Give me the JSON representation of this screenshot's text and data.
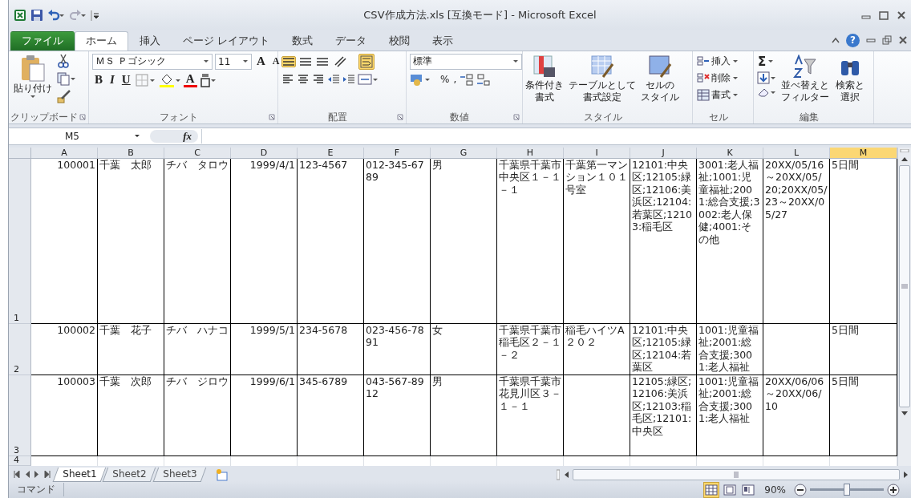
{
  "window": {
    "title": "CSV作成方法.xls  [互換モード] - Microsoft Excel"
  },
  "tabs": [
    {
      "label": "ファイル",
      "kind": "file",
      "selected": false
    },
    {
      "label": "ホーム",
      "kind": "tab",
      "selected": true
    },
    {
      "label": "挿入",
      "kind": "tab",
      "selected": false
    },
    {
      "label": "ページ レイアウト",
      "kind": "tab",
      "selected": false
    },
    {
      "label": "数式",
      "kind": "tab",
      "selected": false
    },
    {
      "label": "データ",
      "kind": "tab",
      "selected": false
    },
    {
      "label": "校閲",
      "kind": "tab",
      "selected": false
    },
    {
      "label": "表示",
      "kind": "tab",
      "selected": false
    }
  ],
  "help": "?",
  "ribbon": {
    "clipboard": {
      "label": "クリップボード",
      "paste": "貼り付け"
    },
    "font": {
      "label": "フォント",
      "name": "ＭＳ Ｐゴシック",
      "size": "11",
      "grow": "A",
      "shrink": "A",
      "bold": "B",
      "italic": "I",
      "underline": "U",
      "color_letter": "A"
    },
    "alignment": {
      "label": "配置",
      "toggles": [
        {
          "kind": "top",
          "on": true
        },
        {
          "kind": "middle",
          "on": false
        },
        {
          "kind": "bottom",
          "on": false
        },
        {
          "kind": "orientation",
          "on": false
        },
        {
          "kind": "wrap",
          "on": true
        }
      ]
    },
    "number": {
      "label": "数値",
      "format": "標準",
      "percent": "%",
      "comma": ","
    },
    "styles": {
      "label": "スタイル",
      "buttons": [
        {
          "lines": [
            "条件付き",
            "書式"
          ]
        },
        {
          "lines": [
            "テーブルとして",
            "書式設定"
          ]
        },
        {
          "lines": [
            "セルの",
            "スタイル"
          ]
        }
      ]
    },
    "cells": {
      "label": "セル",
      "buttons": [
        "挿入",
        "削除",
        "書式"
      ]
    },
    "editing": {
      "label": "編集",
      "sum": "Σ",
      "buttons": [
        {
          "lines": [
            "並べ替えと",
            "フィルター"
          ]
        },
        {
          "lines": [
            "検索と",
            "選択"
          ]
        }
      ]
    }
  },
  "formula_bar": {
    "name_box": "M5",
    "function_label": "fx"
  },
  "sheet": {
    "columns": [
      {
        "label": "A",
        "kind": "number",
        "selected": false
      },
      {
        "label": "B",
        "kind": "text",
        "selected": false
      },
      {
        "label": "C",
        "kind": "text",
        "selected": false
      },
      {
        "label": "D",
        "kind": "number",
        "selected": false
      },
      {
        "label": "E",
        "kind": "text",
        "selected": false
      },
      {
        "label": "F",
        "kind": "text",
        "selected": false
      },
      {
        "label": "G",
        "kind": "text",
        "selected": false
      },
      {
        "label": "H",
        "kind": "text",
        "selected": false
      },
      {
        "label": "I",
        "kind": "text",
        "selected": false
      },
      {
        "label": "J",
        "kind": "text",
        "selected": false
      },
      {
        "label": "K",
        "kind": "text",
        "selected": false
      },
      {
        "label": "L",
        "kind": "text",
        "selected": false
      },
      {
        "label": "M",
        "kind": "text",
        "selected": true
      }
    ],
    "rows": [
      {
        "number": "1",
        "cells": [
          "100001",
          "千葉　太郎",
          "チバ　タロウ",
          "1999/4/1",
          "123-4567",
          "012-345-6789",
          "男",
          "千葉県千葉市中央区１－１－１",
          "千葉第一マンション１０１号室",
          "12101:中央区;12105:緑区;12106:美浜区;12104:若葉区;12103:稲毛区",
          "3001:老人福祉;1001:児童福祉;2001:総合支援;3002:老人保健;4001:その他",
          "20XX/05/16～20XX/05/20;20XX/05/23～20XX/05/27",
          "5日間"
        ]
      },
      {
        "number": "2",
        "cells": [
          "100002",
          "千葉　花子",
          "チバ　ハナコ",
          "1999/5/1",
          "234-5678",
          "023-456-7891",
          "女",
          "千葉県千葉市稲毛区２－１－２",
          "稲毛ハイツA２０２",
          "12101:中央区;12105:緑区;12104:若葉区",
          "1001:児童福祉;2001:総合支援;3001:老人福祉",
          null,
          "5日間"
        ]
      },
      {
        "number": "3",
        "cells": [
          "100003",
          "千葉　次郎",
          "チバ　ジロウ",
          "1999/6/1",
          "345-6789",
          "043-567-8912",
          "男",
          "千葉県千葉市花見川区３－１－１",
          null,
          "12105:緑区;12106:美浜区;12103:稲毛区;12101:中央区",
          "1001:児童福祉;2001:総合支援;3001:老人福祉",
          "20XX/06/06～20XX/06/10",
          "5日間"
        ]
      },
      {
        "number": "4"
      }
    ]
  },
  "sheet_tabs": [
    {
      "label": "Sheet1",
      "selected": true
    },
    {
      "label": "Sheet2",
      "selected": false
    },
    {
      "label": "Sheet3",
      "selected": false
    }
  ],
  "status_bar": {
    "mode": "コマンド",
    "views": [
      {
        "kind": "normal",
        "selected": true
      },
      {
        "kind": "page-layout",
        "selected": false
      },
      {
        "kind": "page-break",
        "selected": false
      }
    ],
    "zoom": "90%",
    "zoom_level": {
      "level": 0.5
    }
  }
}
